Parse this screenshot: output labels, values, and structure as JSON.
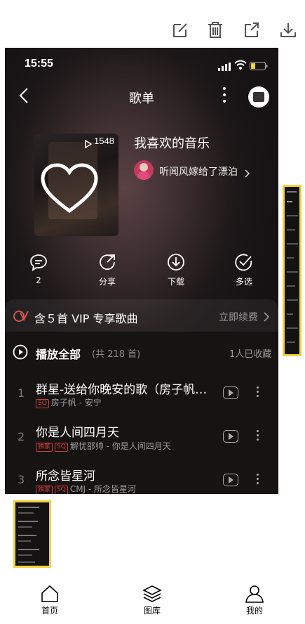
{
  "toolbar": {
    "icons": [
      "edit-icon",
      "trash-icon",
      "share-icon",
      "download-icon"
    ]
  },
  "status": {
    "time": "15:55"
  },
  "header": {
    "title": "歌单"
  },
  "playlist": {
    "play_count": "1548",
    "title": "我喜欢的音乐",
    "creator": "听闻风嫁给了漂泊"
  },
  "actions": [
    {
      "label": "2"
    },
    {
      "label": "分享"
    },
    {
      "label": "下载"
    },
    {
      "label": "多选"
    }
  ],
  "vip": {
    "text": "含５首 VIP 专享歌曲",
    "renew": "立即续费"
  },
  "list_header": {
    "play_all": "播放全部",
    "count": "(共 218 首)",
    "collect": "1人已收藏"
  },
  "songs": [
    {
      "index": "1",
      "title": "群星-送给你晚安的歌（房子帆…",
      "badges": [
        "SQ"
      ],
      "sub": "房子帆 - 安宁"
    },
    {
      "index": "2",
      "title": "你是人间四月天",
      "badges": [
        "独家",
        "SQ"
      ],
      "sub": "解忧邵帅 - 你是人间四月天"
    },
    {
      "index": "3",
      "title": "所念皆星河",
      "badges": [
        "独家",
        "SQ"
      ],
      "sub": "CMJ - 所念皆星河"
    }
  ],
  "nav": [
    {
      "label": "首页"
    },
    {
      "label": "图库"
    },
    {
      "label": "我的"
    }
  ]
}
